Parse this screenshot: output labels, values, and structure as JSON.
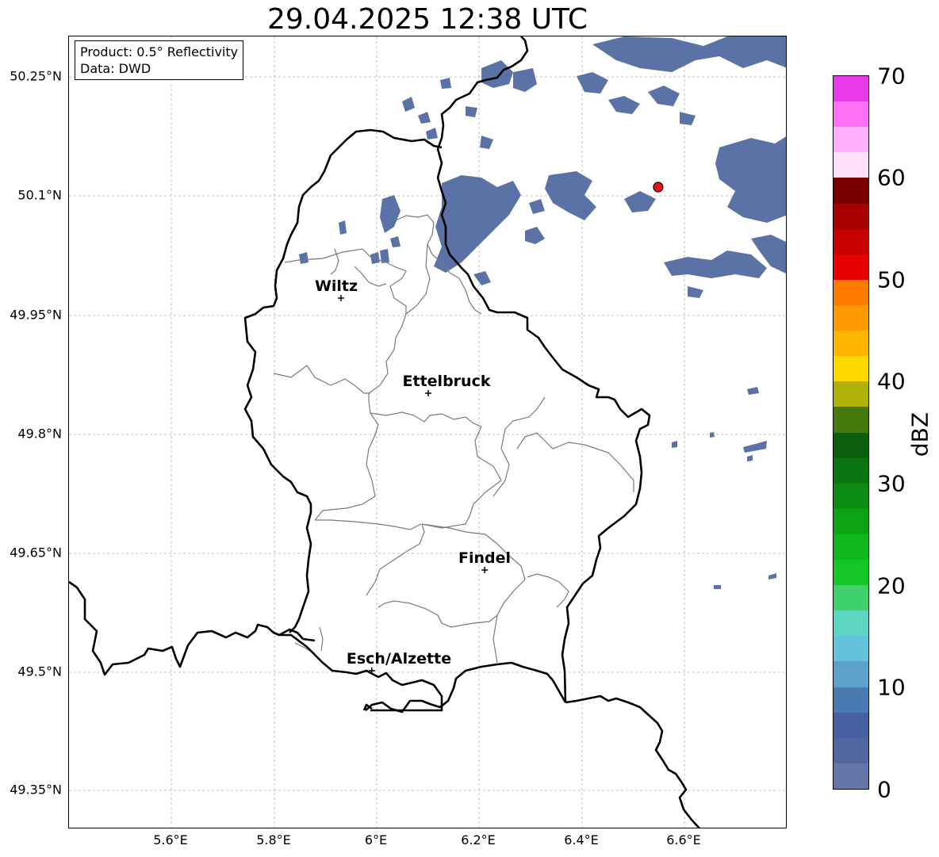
{
  "title": "29.04.2025 12:38 UTC",
  "info": {
    "line1": "Product: 0.5° Reflectivity",
    "line2": "Data: DWD"
  },
  "axes": {
    "lon_ticks": [
      "5.6°E",
      "5.8°E",
      "6°E",
      "6.2°E",
      "6.4°E",
      "6.6°E"
    ],
    "lat_ticks": [
      "50.25°N",
      "50.1°N",
      "49.95°N",
      "49.8°N",
      "49.65°N",
      "49.5°N",
      "49.35°N"
    ],
    "lon_range": [
      5.4,
      6.8
    ],
    "lat_range": [
      49.3,
      50.3
    ]
  },
  "cities": [
    {
      "name": "Wiltz",
      "lon": 5.93,
      "lat": 49.97
    },
    {
      "name": "Ettelbruck",
      "lon": 6.1,
      "lat": 49.85
    },
    {
      "name": "Findel",
      "lon": 6.21,
      "lat": 49.627
    },
    {
      "name": "Esch/Alzette",
      "lon": 5.99,
      "lat": 49.5
    }
  ],
  "radar_site": {
    "lon": 6.548,
    "lat": 50.11,
    "color": "#e8141a"
  },
  "colorbar": {
    "label": "dBZ",
    "ticks": [
      "0",
      "10",
      "20",
      "30",
      "40",
      "50",
      "60",
      "70"
    ],
    "colors": [
      "#6477a8",
      "#52669f",
      "#4561a2",
      "#4a7ab1",
      "#5aa2c9",
      "#64c2db",
      "#5dd6c2",
      "#3fd26c",
      "#13c825",
      "#10b81d",
      "#0ea314",
      "#0c8c12",
      "#0b7611",
      "#0a5e0c",
      "#45790c",
      "#afb20b",
      "#ffd800",
      "#ffb400",
      "#ff9800",
      "#ff7a00",
      "#e80000",
      "#c80000",
      "#a80000",
      "#7a0000",
      "#ffe0fb",
      "#ffb0f8",
      "#ff70f4",
      "#e83ae8"
    ]
  },
  "echo_color": "#5a72a6"
}
